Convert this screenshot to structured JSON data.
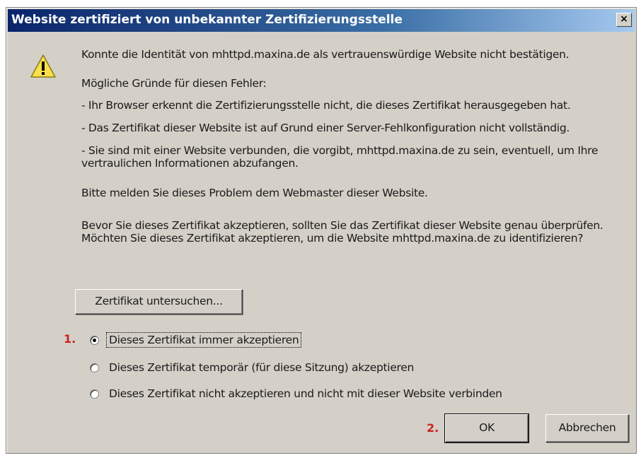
{
  "dialog": {
    "title": "Website zertifiziert von unbekannter Zertifizierungsstelle",
    "close_label": "×"
  },
  "icons": {
    "warning": "warning-triangle-icon",
    "close": "close-icon"
  },
  "body": {
    "intro": "Konnte die Identität von mhttpd.maxina.de als vertrauenswürdige Website nicht bestätigen.",
    "reasons_heading": "Mögliche Gründe für diesen Fehler:",
    "reasons": [
      "- Ihr Browser erkennt die Zertifizierungsstelle nicht, die dieses Zertifikat herausgegeben hat.",
      "- Das Zertifikat dieser Website ist auf Grund einer Server-Fehlkonfiguration nicht vollständig.",
      "- Sie sind mit einer Website verbunden, die vorgibt, mhttpd.maxina.de zu sein, eventuell, um Ihre vertraulichen Informationen abzufangen."
    ],
    "report": "Bitte melden Sie dieses Problem dem Webmaster dieser Website.",
    "question": "Bevor Sie dieses Zertifikat akzeptieren, sollten Sie das Zertifikat dieser Website genau überprüfen. Möchten Sie dieses Zertifikat akzeptieren, um die Website mhttpd.maxina.de zu identifizieren?"
  },
  "examine_button": "Zertifikat untersuchen...",
  "options": [
    {
      "label": "Dieses Zertifikat immer akzeptieren",
      "selected": true
    },
    {
      "label": "Dieses Zertifikat temporär (für diese Sitzung) akzeptieren",
      "selected": false
    },
    {
      "label": "Dieses Zertifikat nicht akzeptieren und nicht mit dieser Website verbinden",
      "selected": false
    }
  ],
  "step_markers": {
    "step1": "1.",
    "step2": "2."
  },
  "buttons": {
    "ok": "OK",
    "cancel": "Abbrechen"
  },
  "colors": {
    "title_start": "#0a246a",
    "title_end": "#a6caf0",
    "face": "#d4d0c8",
    "marker": "#cc2222"
  }
}
